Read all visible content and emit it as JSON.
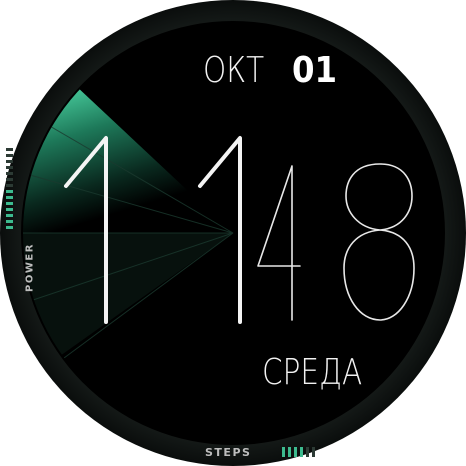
{
  "watch": {
    "month": "ОКТ",
    "day": "01",
    "time_hour": "11",
    "time_minute": "48",
    "weekday": "СРЕДА",
    "steps_label": "STEPS",
    "power_label": "POWER",
    "steps_level_bars": 4,
    "power_level_bars": 7,
    "accent_color": "#3dbb8f",
    "bezel_color": "#101412",
    "face_color": "#000000"
  }
}
